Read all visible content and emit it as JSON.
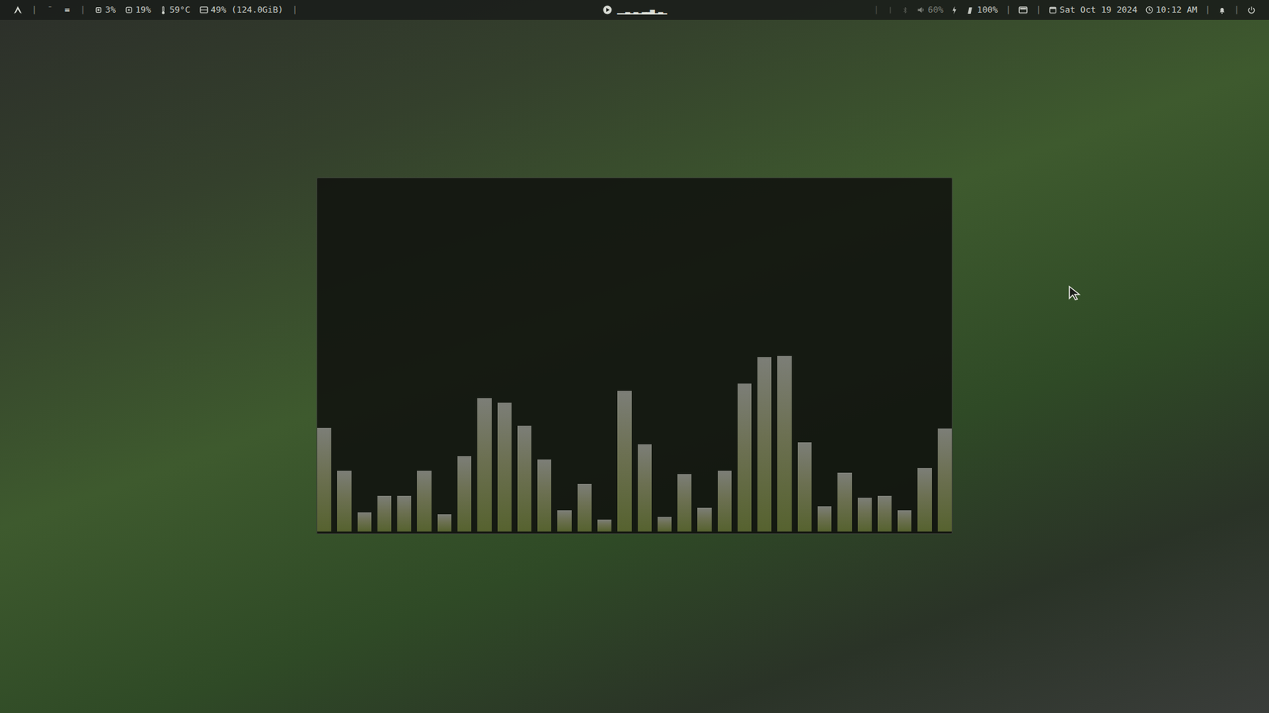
{
  "top_bar": {
    "separator": "|",
    "workspaces": [
      {
        "label": "¯",
        "selected": false
      },
      {
        "label": "=",
        "selected": true
      }
    ],
    "cpu": "3%",
    "memory": "19%",
    "temperature": "59°C",
    "disk": "49% (124.0GiB)",
    "visualizer": "▁▁▂▁▂▁▂▂▄▁▂▁",
    "volume": "60%",
    "battery": "100%",
    "date": "Sat Oct 19 2024",
    "time": "10:12 AM"
  },
  "visualizer_window": {
    "bars": [
      157,
      92,
      29,
      54,
      54,
      92,
      26,
      114,
      202,
      195,
      160,
      109,
      32,
      72,
      18,
      213,
      132,
      22,
      87,
      36,
      92,
      224,
      264,
      266,
      135,
      38,
      89,
      51,
      54,
      32,
      96,
      156
    ]
  }
}
